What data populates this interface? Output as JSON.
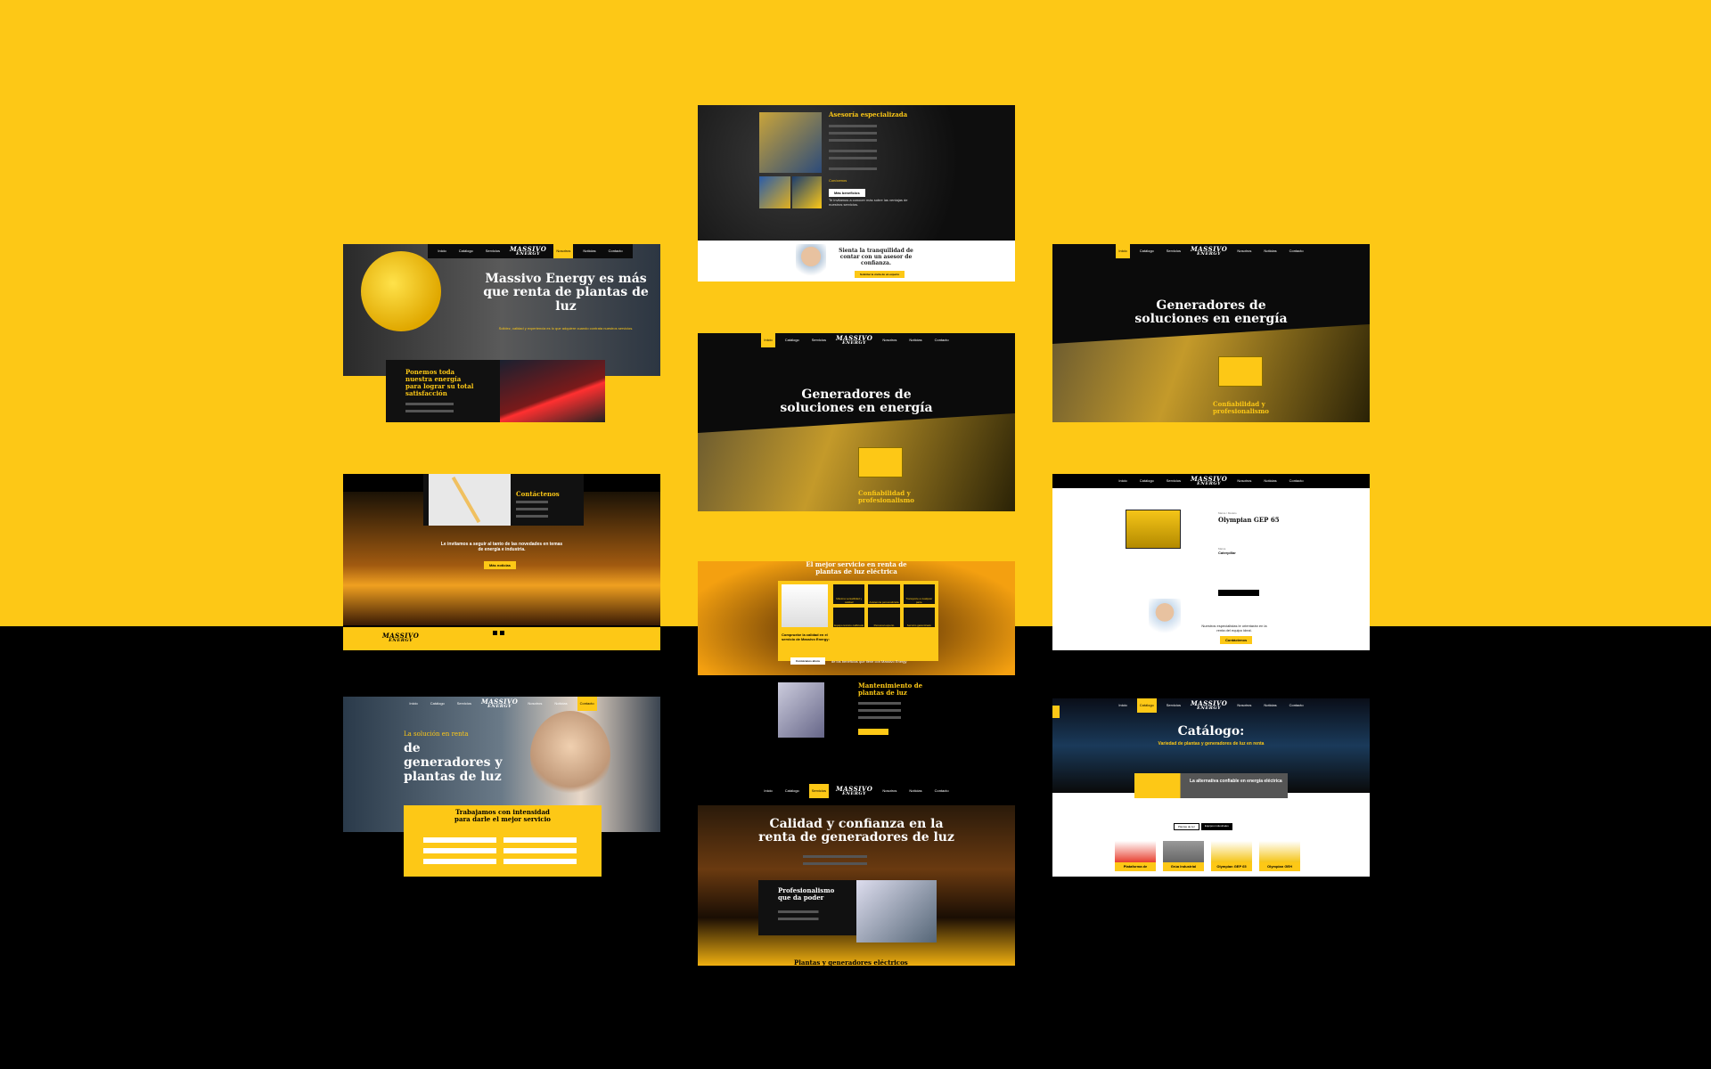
{
  "colors": {
    "accent": "#fdc816",
    "dark": "#0b0b0b"
  },
  "nav_items": [
    "Inicio",
    "Catálogo",
    "Servicios",
    "Nosotros",
    "Noticias",
    "Contacto"
  ],
  "logo": {
    "line1": "MASSIVO",
    "line2": "ENERGY"
  },
  "c1": {
    "title": "Asesoría especializada",
    "subtitle": "Conócenos",
    "btn": "Más beneficios",
    "note": "Te invitamos a conocer más sobre las ventajas de nuestros servicios.",
    "banner_title": "Sienta la tranquilidad de contar con un asesor de confianza.",
    "banner_btn": "Solicitar la visita de un experto"
  },
  "c2": {
    "title": "Massivo Energy es más que renta de plantas de luz",
    "sub": "Solidez, calidad y experiencia es lo que adquiere cuando contrata nuestros servicios.",
    "box": "Ponemos toda nuestra energía para lograr su total satisfacción"
  },
  "c3": {
    "title": "Generadores de soluciones en energía",
    "tag": "Confiabilidad y profesionalismo"
  },
  "c4": {
    "title": "Generadores de soluciones en energía",
    "tag": "Confiabilidad y profesionalismo"
  },
  "c5": {
    "heading": "Contáctenos",
    "invite": "Le invitamos a seguir al tanto de las novedades en temas de energía e industria.",
    "btn": "Más noticias"
  },
  "c6": {
    "brand": "Marca / Modelo",
    "model": "Olympian GEP 65",
    "brand_label": "Marca",
    "brand_val": "Caterpillar",
    "note": "Nuestros especialistas le orientarán en la renta del equipo ideal.",
    "btn": "Contáctenos"
  },
  "c7": {
    "title": "El mejor servicio en renta de plantas de luz eléctrica",
    "check": "Compruebe la calidad en el servicio de Massivo Energy:",
    "btn": "Conózcanos ahora",
    "cta": "de los beneficios que tiene con Massivo Energy",
    "maint": "Mantenimiento de plantas de luz",
    "feats": [
      "Máxima versatilidad y calidad",
      "Asistencia personalizada",
      "Transporte a cualquier parte",
      "Equipo técnico calificado",
      "Personal experto",
      "Servicio garantizado"
    ]
  },
  "c8": {
    "pre": "La solución en renta",
    "title": "de generadores y plantas de luz",
    "form_title": "Trabajamos con intensidad para darle el mejor servicio"
  },
  "c9": {
    "title": "Catálogo:",
    "sub": "Variedad de plantas y generadores de luz en renta",
    "badge": "La alternativa confiable en energía eléctrica",
    "tabs": [
      "Plantas de luz",
      "Equipos industriales"
    ],
    "items": [
      "Plataforma de",
      "Grúa Industrial",
      "Olympian GEP 65",
      "Olympian GEH"
    ]
  },
  "c10": {
    "title": "Calidad y confianza en la renta de generadores de luz",
    "box": "Profesionalismo que da poder",
    "footer": "Plantas y generadores eléctricos"
  }
}
